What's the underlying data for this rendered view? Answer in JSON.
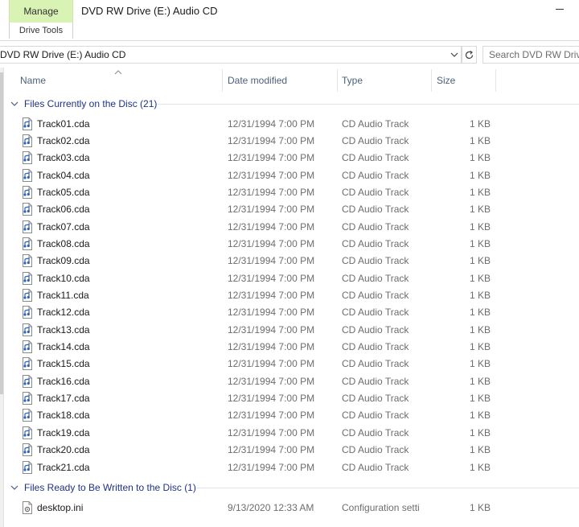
{
  "ribbon": {
    "manage_label": "Manage",
    "drive_tools_label": "Drive Tools",
    "window_title": "DVD RW Drive (E:) Audio CD"
  },
  "address": {
    "path": "DVD RW Drive (E:) Audio CD",
    "search_placeholder": "Search DVD RW Drive (E:) Audio CD"
  },
  "columns": {
    "name": "Name",
    "date": "Date modified",
    "type": "Type",
    "size": "Size"
  },
  "groups": [
    {
      "title": "Files Currently on the Disc (21)",
      "files": [
        {
          "name": "Track01.cda",
          "date": "12/31/1994 7:00 PM",
          "type": "CD Audio Track",
          "size": "1 KB"
        },
        {
          "name": "Track02.cda",
          "date": "12/31/1994 7:00 PM",
          "type": "CD Audio Track",
          "size": "1 KB"
        },
        {
          "name": "Track03.cda",
          "date": "12/31/1994 7:00 PM",
          "type": "CD Audio Track",
          "size": "1 KB"
        },
        {
          "name": "Track04.cda",
          "date": "12/31/1994 7:00 PM",
          "type": "CD Audio Track",
          "size": "1 KB"
        },
        {
          "name": "Track05.cda",
          "date": "12/31/1994 7:00 PM",
          "type": "CD Audio Track",
          "size": "1 KB"
        },
        {
          "name": "Track06.cda",
          "date": "12/31/1994 7:00 PM",
          "type": "CD Audio Track",
          "size": "1 KB"
        },
        {
          "name": "Track07.cda",
          "date": "12/31/1994 7:00 PM",
          "type": "CD Audio Track",
          "size": "1 KB"
        },
        {
          "name": "Track08.cda",
          "date": "12/31/1994 7:00 PM",
          "type": "CD Audio Track",
          "size": "1 KB"
        },
        {
          "name": "Track09.cda",
          "date": "12/31/1994 7:00 PM",
          "type": "CD Audio Track",
          "size": "1 KB"
        },
        {
          "name": "Track10.cda",
          "date": "12/31/1994 7:00 PM",
          "type": "CD Audio Track",
          "size": "1 KB"
        },
        {
          "name": "Track11.cda",
          "date": "12/31/1994 7:00 PM",
          "type": "CD Audio Track",
          "size": "1 KB"
        },
        {
          "name": "Track12.cda",
          "date": "12/31/1994 7:00 PM",
          "type": "CD Audio Track",
          "size": "1 KB"
        },
        {
          "name": "Track13.cda",
          "date": "12/31/1994 7:00 PM",
          "type": "CD Audio Track",
          "size": "1 KB"
        },
        {
          "name": "Track14.cda",
          "date": "12/31/1994 7:00 PM",
          "type": "CD Audio Track",
          "size": "1 KB"
        },
        {
          "name": "Track15.cda",
          "date": "12/31/1994 7:00 PM",
          "type": "CD Audio Track",
          "size": "1 KB"
        },
        {
          "name": "Track16.cda",
          "date": "12/31/1994 7:00 PM",
          "type": "CD Audio Track",
          "size": "1 KB"
        },
        {
          "name": "Track17.cda",
          "date": "12/31/1994 7:00 PM",
          "type": "CD Audio Track",
          "size": "1 KB"
        },
        {
          "name": "Track18.cda",
          "date": "12/31/1994 7:00 PM",
          "type": "CD Audio Track",
          "size": "1 KB"
        },
        {
          "name": "Track19.cda",
          "date": "12/31/1994 7:00 PM",
          "type": "CD Audio Track",
          "size": "1 KB"
        },
        {
          "name": "Track20.cda",
          "date": "12/31/1994 7:00 PM",
          "type": "CD Audio Track",
          "size": "1 KB"
        },
        {
          "name": "Track21.cda",
          "date": "12/31/1994 7:00 PM",
          "type": "CD Audio Track",
          "size": "1 KB"
        }
      ]
    },
    {
      "title": "Files Ready to Be Written to the Disc (1)",
      "files": [
        {
          "name": "desktop.ini",
          "date": "9/13/2020 12:33 AM",
          "type": "Configuration setti",
          "size": "1 KB"
        }
      ]
    }
  ],
  "icons": {
    "audio_file": "audio-track-file-icon",
    "settings_file": "configuration-file-icon",
    "group_toggle": "chevron-down-icon",
    "refresh": "refresh-icon",
    "dropdown": "chevron-down-icon",
    "sort": "sort-ascending-icon"
  },
  "colors": {
    "manage_tab": "#d8f3b4",
    "group_title": "#1e3287",
    "header_text": "#4c607a",
    "secondary_text": "#6d6d6d"
  }
}
